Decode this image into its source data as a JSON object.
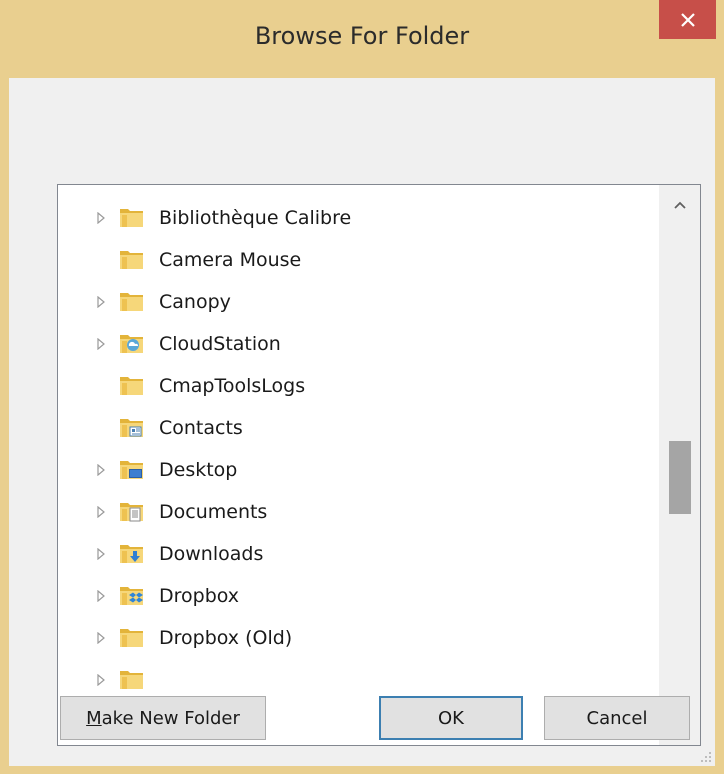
{
  "window": {
    "title": "Browse For Folder",
    "close_icon": "close-icon"
  },
  "tree": {
    "items": [
      {
        "label": "Bibliothèque Calibre",
        "expandable": true,
        "icon": "folder-icon"
      },
      {
        "label": "Camera Mouse",
        "expandable": false,
        "icon": "folder-icon"
      },
      {
        "label": "Canopy",
        "expandable": true,
        "icon": "folder-icon"
      },
      {
        "label": "CloudStation",
        "expandable": true,
        "icon": "cloudstation-folder-icon"
      },
      {
        "label": "CmapToolsLogs",
        "expandable": false,
        "icon": "folder-icon"
      },
      {
        "label": "Contacts",
        "expandable": false,
        "icon": "contacts-folder-icon"
      },
      {
        "label": "Desktop",
        "expandable": true,
        "icon": "desktop-folder-icon"
      },
      {
        "label": "Documents",
        "expandable": true,
        "icon": "documents-folder-icon"
      },
      {
        "label": "Downloads",
        "expandable": true,
        "icon": "downloads-folder-icon"
      },
      {
        "label": "Dropbox",
        "expandable": true,
        "icon": "dropbox-folder-icon"
      },
      {
        "label": "Dropbox (Old)",
        "expandable": true,
        "icon": "folder-icon"
      },
      {
        "label": "",
        "expandable": true,
        "icon": "folder-icon"
      }
    ],
    "scroll_position": 0.5
  },
  "buttons": {
    "make_new_folder_mnemonic": "M",
    "make_new_folder_rest": "ake New Folder",
    "ok": "OK",
    "cancel": "Cancel"
  },
  "colors": {
    "titlebar": "#e9cf8f",
    "close_button": "#c74f49",
    "client": "#f0f0f0",
    "default_button_border": "#3c7fb1"
  }
}
